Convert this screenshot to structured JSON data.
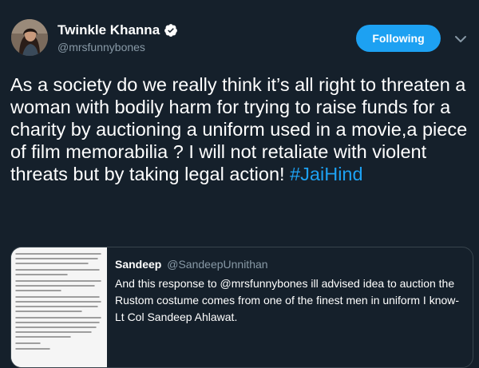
{
  "tweet": {
    "author": {
      "name": "Twinkle Khanna",
      "handle": "@mrsfunnybones",
      "verified_icon": "verified-badge-icon"
    },
    "follow_button_label": "Following",
    "menu_icon": "chevron-down-icon",
    "text": "As a society do we really think it’s all right to threaten a woman with bodily harm for trying to raise funds for a charity by auctioning a uniform used in a movie,a piece of film memorabilia ? I will not retaliate with violent threats but by taking legal action! ",
    "hashtag": "#JaiHind"
  },
  "quoted_tweet": {
    "author_name": "Sandeep",
    "author_handle": "@SandeepUnnithan",
    "text": "And this response to @mrsfunnybones  ill advised idea to auction the Rustom costume comes from one of the finest men in uniform I know- Lt Col Sandeep Ahlawat."
  },
  "colors": {
    "background": "#15202b",
    "accent": "#1da1f2",
    "secondary_text": "#8899a6",
    "border": "#38444d"
  }
}
